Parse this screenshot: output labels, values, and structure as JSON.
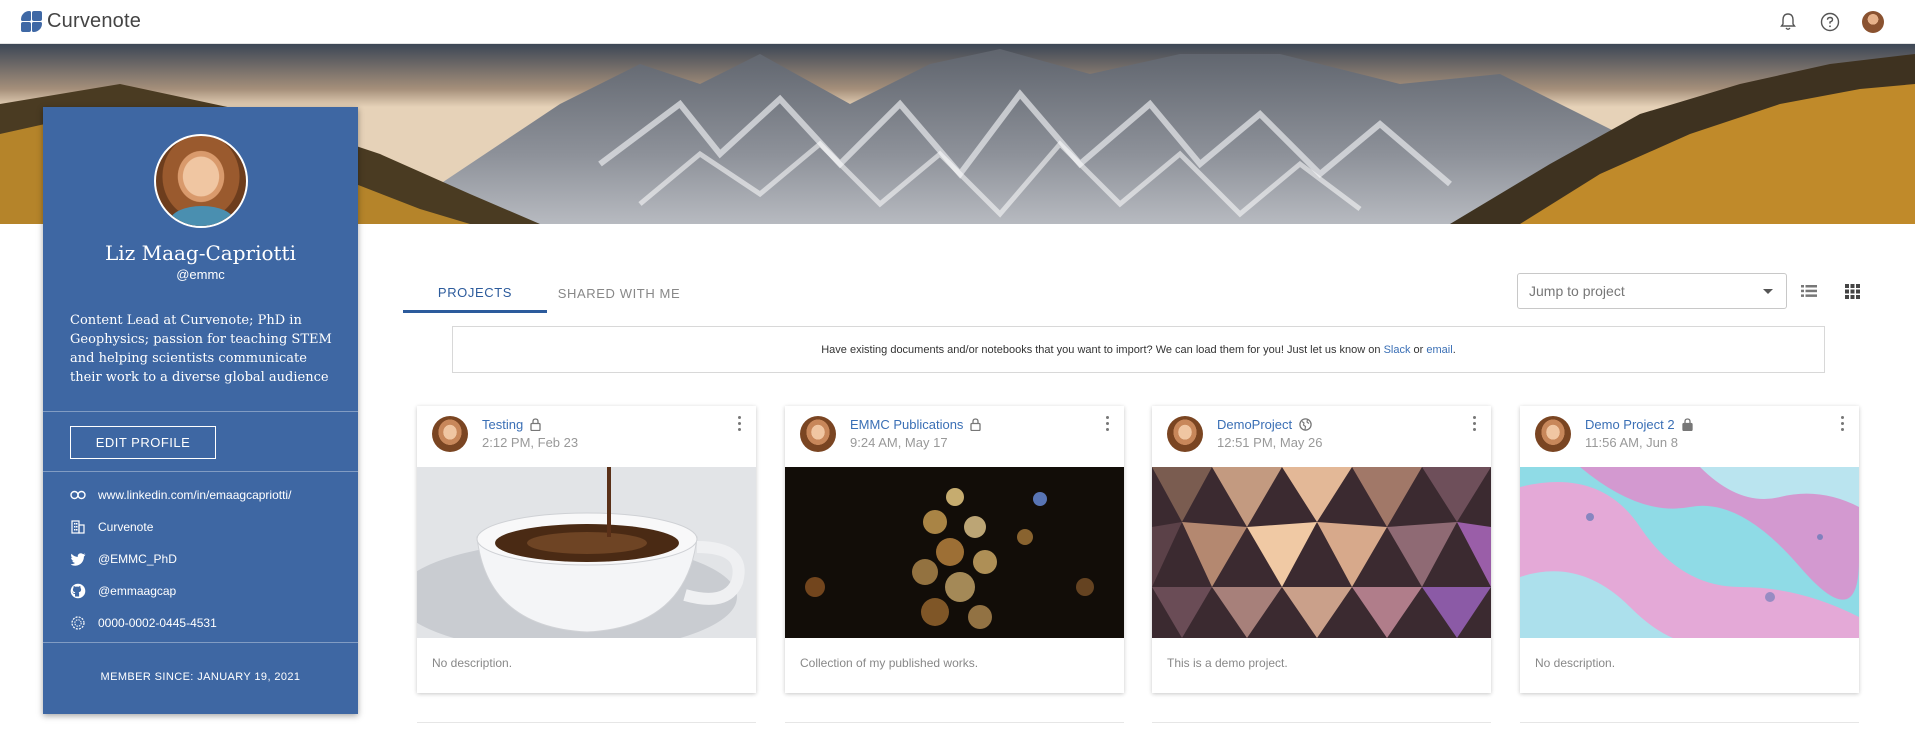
{
  "app": {
    "name": "Curvenote"
  },
  "profile": {
    "name": "Liz Maag-Capriotti",
    "handle": "@emmc",
    "bio": "Content Lead at Curvenote; PhD in Geophysics; passion for teaching STEM and helping scientists communicate their work to a diverse global audience",
    "edit_label": "EDIT PROFILE",
    "links": {
      "website": "www.linkedin.com/in/emaagcapriotti/",
      "organization": "Curvenote",
      "twitter": "@EMMC_PhD",
      "github": "@emmaagcap",
      "orcid": "0000-0002-0445-4531"
    },
    "member_since": "MEMBER SINCE: JANUARY 19, 2021"
  },
  "tabs": [
    {
      "label": "PROJECTS",
      "active": true
    },
    {
      "label": "SHARED WITH ME",
      "active": false
    }
  ],
  "jump": {
    "placeholder": "Jump to project"
  },
  "import_notice": {
    "text": "Have existing documents and/or notebooks that you want to import? We can load them for you! Just let us know on",
    "slack": "Slack",
    "or": "or",
    "email": "email",
    "end": "."
  },
  "projects": [
    {
      "title": "Testing",
      "visibility": "lock-icon",
      "date": "2:12 PM, Feb 23",
      "description": "No description.",
      "image": "coffee"
    },
    {
      "title": "EMMC Publications",
      "visibility": "lock-icon",
      "date": "9:24 AM, May 17",
      "description": "Collection of my published works.",
      "image": "bokeh"
    },
    {
      "title": "DemoProject",
      "visibility": "globe-icon",
      "date": "12:51 PM, May 26",
      "description": "This is a demo project.",
      "image": "triangles"
    },
    {
      "title": "Demo Project 2",
      "visibility": "lock-icon",
      "date": "11:56 AM, Jun 8",
      "description": "No description.",
      "image": "fluid"
    }
  ],
  "colors": {
    "accent": "#3e67a3",
    "link": "#3a6fb5"
  }
}
